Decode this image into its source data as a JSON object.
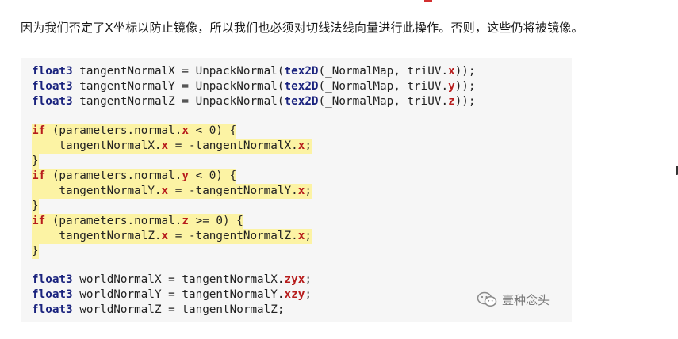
{
  "paragraph": "因为我们否定了X坐标以防止镜像，所以我们也必须对切线法线向量进行此操作。否则，这些仍将被镜像。",
  "code": {
    "lines": [
      {
        "highlight": false,
        "tokens": [
          {
            "t": "float3",
            "c": "kw"
          },
          {
            "t": " tangentNormalX = UnpackNormal(",
            "c": ""
          },
          {
            "t": "tex2D",
            "c": "fn"
          },
          {
            "t": "(_NormalMap, triUV.",
            "c": ""
          },
          {
            "t": "x",
            "c": "red"
          },
          {
            "t": "));",
            "c": ""
          }
        ]
      },
      {
        "highlight": false,
        "tokens": [
          {
            "t": "float3",
            "c": "kw"
          },
          {
            "t": " tangentNormalY = UnpackNormal(",
            "c": ""
          },
          {
            "t": "tex2D",
            "c": "fn"
          },
          {
            "t": "(_NormalMap, triUV.",
            "c": ""
          },
          {
            "t": "y",
            "c": "red"
          },
          {
            "t": "));",
            "c": ""
          }
        ]
      },
      {
        "highlight": false,
        "tokens": [
          {
            "t": "float3",
            "c": "kw"
          },
          {
            "t": " tangentNormalZ = UnpackNormal(",
            "c": ""
          },
          {
            "t": "tex2D",
            "c": "fn"
          },
          {
            "t": "(_NormalMap, triUV.",
            "c": ""
          },
          {
            "t": "z",
            "c": "red"
          },
          {
            "t": "));",
            "c": ""
          }
        ]
      },
      {
        "highlight": false,
        "tokens": []
      },
      {
        "highlight": true,
        "tokens": [
          {
            "t": "if",
            "c": "red"
          },
          {
            "t": " (parameters.normal.",
            "c": ""
          },
          {
            "t": "x",
            "c": "red"
          },
          {
            "t": " < 0) {",
            "c": ""
          }
        ]
      },
      {
        "highlight": true,
        "tokens": [
          {
            "t": "    tangentNormalX.",
            "c": ""
          },
          {
            "t": "x",
            "c": "red"
          },
          {
            "t": " = -tangentNormalX.",
            "c": ""
          },
          {
            "t": "x",
            "c": "red"
          },
          {
            "t": ";",
            "c": ""
          }
        ]
      },
      {
        "highlight": true,
        "tokens": [
          {
            "t": "}",
            "c": ""
          }
        ]
      },
      {
        "highlight": true,
        "tokens": [
          {
            "t": "if",
            "c": "red"
          },
          {
            "t": " (parameters.normal.",
            "c": ""
          },
          {
            "t": "y",
            "c": "red"
          },
          {
            "t": " < 0) {",
            "c": ""
          }
        ]
      },
      {
        "highlight": true,
        "tokens": [
          {
            "t": "    tangentNormalY.",
            "c": ""
          },
          {
            "t": "x",
            "c": "red"
          },
          {
            "t": " = -tangentNormalY.",
            "c": ""
          },
          {
            "t": "x",
            "c": "red"
          },
          {
            "t": ";",
            "c": ""
          }
        ]
      },
      {
        "highlight": true,
        "tokens": [
          {
            "t": "}",
            "c": ""
          }
        ]
      },
      {
        "highlight": true,
        "tokens": [
          {
            "t": "if",
            "c": "red"
          },
          {
            "t": " (parameters.normal.",
            "c": ""
          },
          {
            "t": "z",
            "c": "red"
          },
          {
            "t": " >= 0) {",
            "c": ""
          }
        ]
      },
      {
        "highlight": true,
        "tokens": [
          {
            "t": "    tangentNormalZ.",
            "c": ""
          },
          {
            "t": "x",
            "c": "red"
          },
          {
            "t": " = -tangentNormalZ.",
            "c": ""
          },
          {
            "t": "x",
            "c": "red"
          },
          {
            "t": ";",
            "c": ""
          }
        ]
      },
      {
        "highlight": true,
        "tokens": [
          {
            "t": "}",
            "c": ""
          }
        ]
      },
      {
        "highlight": false,
        "tokens": []
      },
      {
        "highlight": false,
        "tokens": [
          {
            "t": "float3",
            "c": "kw"
          },
          {
            "t": " worldNormalX = tangentNormalX.",
            "c": ""
          },
          {
            "t": "zyx",
            "c": "red"
          },
          {
            "t": ";",
            "c": ""
          }
        ]
      },
      {
        "highlight": false,
        "tokens": [
          {
            "t": "float3",
            "c": "kw"
          },
          {
            "t": " worldNormalY = tangentNormalY.",
            "c": ""
          },
          {
            "t": "xzy",
            "c": "red"
          },
          {
            "t": ";",
            "c": ""
          }
        ]
      },
      {
        "highlight": false,
        "tokens": [
          {
            "t": "float3",
            "c": "kw"
          },
          {
            "t": " worldNormalZ = tangentNormalZ;",
            "c": ""
          }
        ]
      }
    ]
  },
  "watermark": {
    "icon": "wechat-icon",
    "text": "壹种念头"
  },
  "colors": {
    "highlight": "#fcf3a4",
    "keyword": "#1a237e",
    "accent_red": "#b71c1c",
    "code_bg": "#f6f6f6"
  }
}
